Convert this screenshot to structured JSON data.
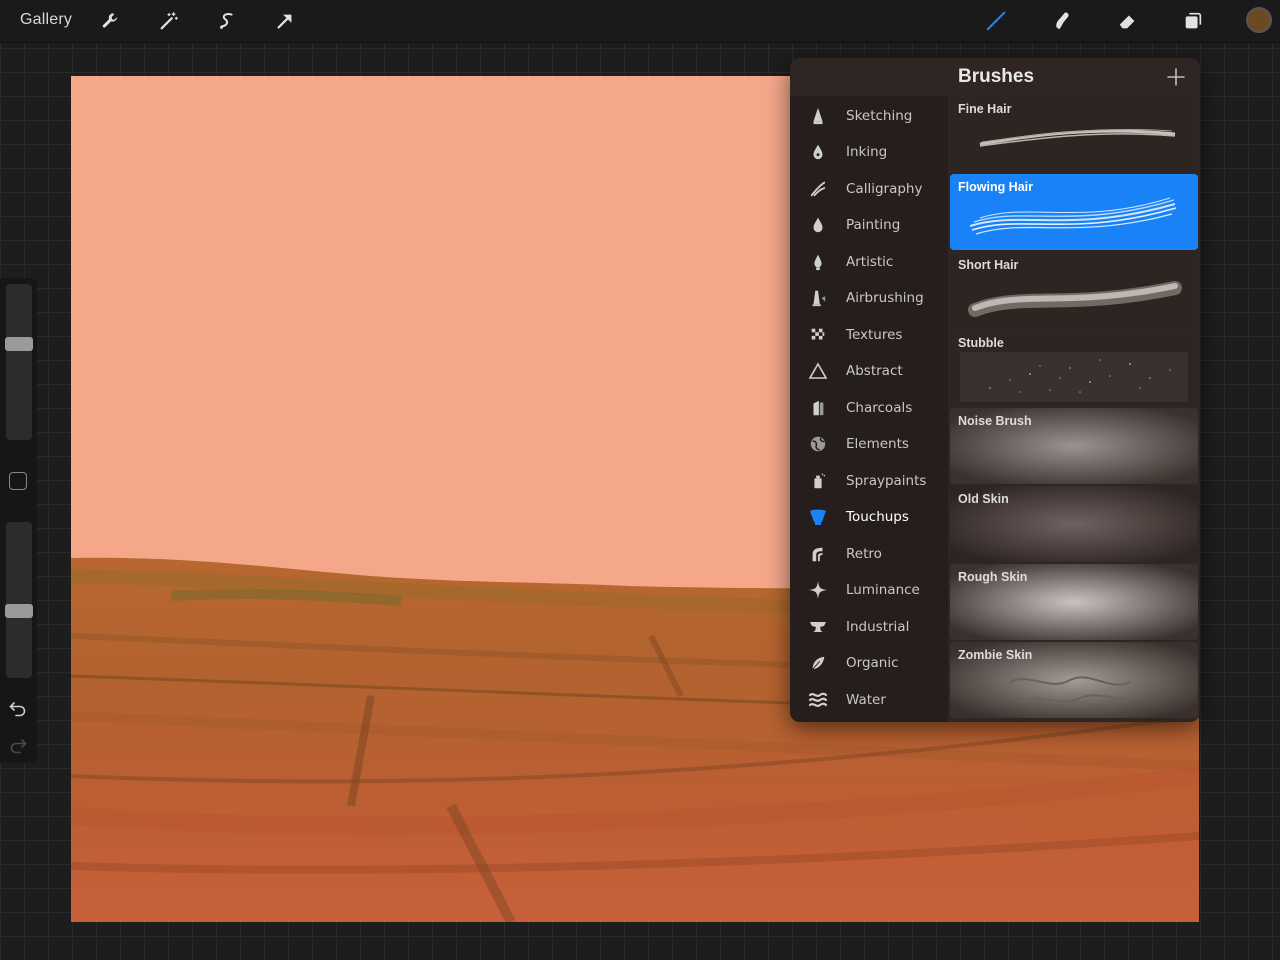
{
  "toolbar": {
    "gallery_label": "Gallery",
    "tools": [
      "wrench-icon",
      "magic-wand-icon",
      "selection-icon",
      "transform-arrow-icon"
    ],
    "right_tools": [
      "brush-icon",
      "smudge-icon",
      "eraser-icon",
      "layers-icon"
    ],
    "active_tool": "brush-icon",
    "current_color": "#6b4a22",
    "accent_color": "#1a82f7"
  },
  "sidebar": {
    "size_level": 0.63,
    "opacity_level": 0.42
  },
  "brushes_panel": {
    "title": "Brushes",
    "categories": [
      {
        "label": "Sketching",
        "icon": "pencil-tip-icon"
      },
      {
        "label": "Inking",
        "icon": "ink-drop-icon"
      },
      {
        "label": "Calligraphy",
        "icon": "calligraphy-icon"
      },
      {
        "label": "Painting",
        "icon": "paint-drop-icon"
      },
      {
        "label": "Artistic",
        "icon": "artistic-drop-icon"
      },
      {
        "label": "Airbrushing",
        "icon": "airbrush-icon"
      },
      {
        "label": "Textures",
        "icon": "checker-icon"
      },
      {
        "label": "Abstract",
        "icon": "triangle-icon"
      },
      {
        "label": "Charcoals",
        "icon": "charcoal-icon"
      },
      {
        "label": "Elements",
        "icon": "globe-icon"
      },
      {
        "label": "Spraypaints",
        "icon": "spray-can-icon"
      },
      {
        "label": "Touchups",
        "icon": "touchup-icon"
      },
      {
        "label": "Retro",
        "icon": "retro-icon"
      },
      {
        "label": "Luminance",
        "icon": "sparkle-icon"
      },
      {
        "label": "Industrial",
        "icon": "anvil-icon"
      },
      {
        "label": "Organic",
        "icon": "leaf-icon"
      },
      {
        "label": "Water",
        "icon": "waves-icon"
      }
    ],
    "selected_category": "Touchups",
    "brushes": [
      {
        "name": "Fine Hair"
      },
      {
        "name": "Flowing Hair"
      },
      {
        "name": "Short Hair"
      },
      {
        "name": "Stubble"
      },
      {
        "name": "Noise Brush"
      },
      {
        "name": "Old Skin"
      },
      {
        "name": "Rough Skin"
      },
      {
        "name": "Zombie Skin"
      }
    ],
    "selected_brush": "Flowing Hair"
  }
}
